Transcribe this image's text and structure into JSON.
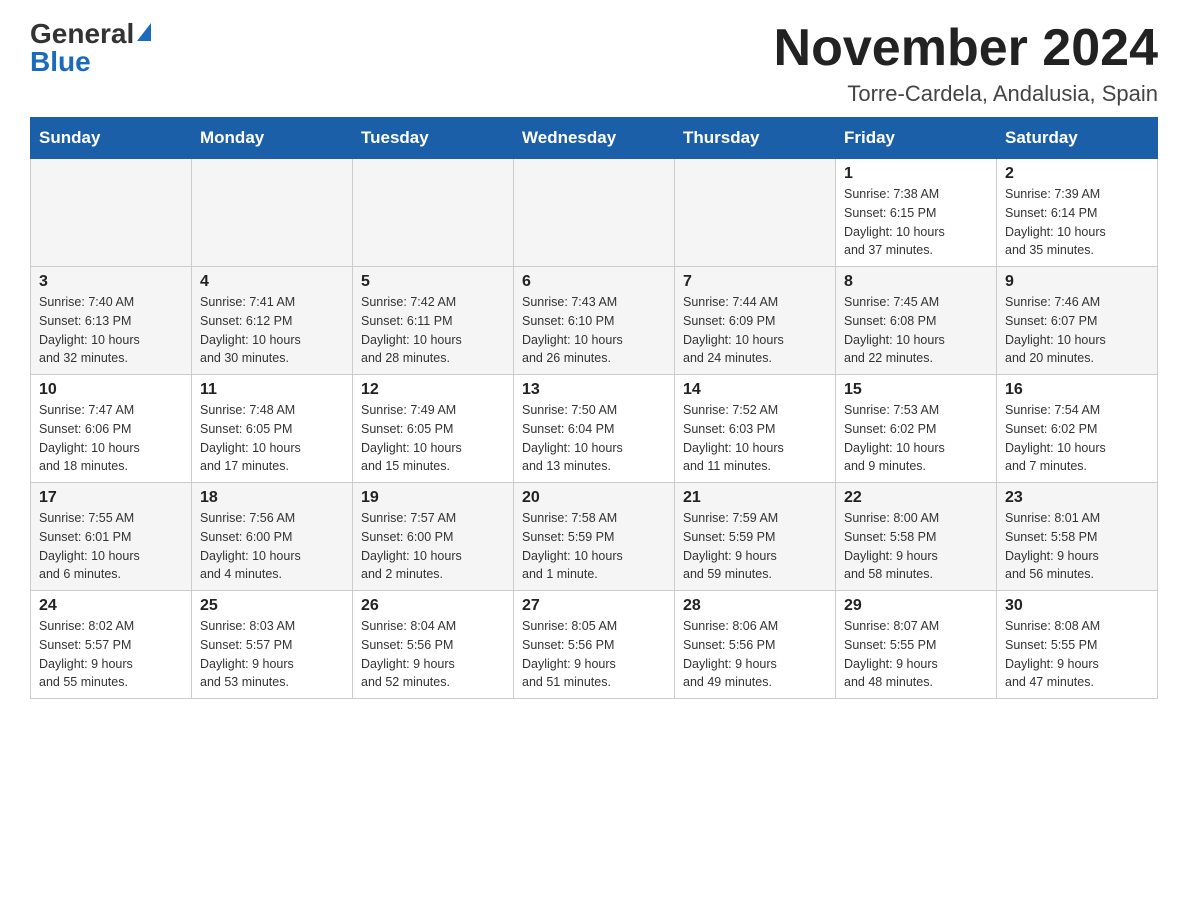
{
  "logo": {
    "line1": "General",
    "line2": "Blue"
  },
  "header": {
    "month": "November 2024",
    "location": "Torre-Cardela, Andalusia, Spain"
  },
  "days_of_week": [
    "Sunday",
    "Monday",
    "Tuesday",
    "Wednesday",
    "Thursday",
    "Friday",
    "Saturday"
  ],
  "weeks": [
    {
      "days": [
        {
          "num": "",
          "info": ""
        },
        {
          "num": "",
          "info": ""
        },
        {
          "num": "",
          "info": ""
        },
        {
          "num": "",
          "info": ""
        },
        {
          "num": "",
          "info": ""
        },
        {
          "num": "1",
          "info": "Sunrise: 7:38 AM\nSunset: 6:15 PM\nDaylight: 10 hours\nand 37 minutes."
        },
        {
          "num": "2",
          "info": "Sunrise: 7:39 AM\nSunset: 6:14 PM\nDaylight: 10 hours\nand 35 minutes."
        }
      ]
    },
    {
      "days": [
        {
          "num": "3",
          "info": "Sunrise: 7:40 AM\nSunset: 6:13 PM\nDaylight: 10 hours\nand 32 minutes."
        },
        {
          "num": "4",
          "info": "Sunrise: 7:41 AM\nSunset: 6:12 PM\nDaylight: 10 hours\nand 30 minutes."
        },
        {
          "num": "5",
          "info": "Sunrise: 7:42 AM\nSunset: 6:11 PM\nDaylight: 10 hours\nand 28 minutes."
        },
        {
          "num": "6",
          "info": "Sunrise: 7:43 AM\nSunset: 6:10 PM\nDaylight: 10 hours\nand 26 minutes."
        },
        {
          "num": "7",
          "info": "Sunrise: 7:44 AM\nSunset: 6:09 PM\nDaylight: 10 hours\nand 24 minutes."
        },
        {
          "num": "8",
          "info": "Sunrise: 7:45 AM\nSunset: 6:08 PM\nDaylight: 10 hours\nand 22 minutes."
        },
        {
          "num": "9",
          "info": "Sunrise: 7:46 AM\nSunset: 6:07 PM\nDaylight: 10 hours\nand 20 minutes."
        }
      ]
    },
    {
      "days": [
        {
          "num": "10",
          "info": "Sunrise: 7:47 AM\nSunset: 6:06 PM\nDaylight: 10 hours\nand 18 minutes."
        },
        {
          "num": "11",
          "info": "Sunrise: 7:48 AM\nSunset: 6:05 PM\nDaylight: 10 hours\nand 17 minutes."
        },
        {
          "num": "12",
          "info": "Sunrise: 7:49 AM\nSunset: 6:05 PM\nDaylight: 10 hours\nand 15 minutes."
        },
        {
          "num": "13",
          "info": "Sunrise: 7:50 AM\nSunset: 6:04 PM\nDaylight: 10 hours\nand 13 minutes."
        },
        {
          "num": "14",
          "info": "Sunrise: 7:52 AM\nSunset: 6:03 PM\nDaylight: 10 hours\nand 11 minutes."
        },
        {
          "num": "15",
          "info": "Sunrise: 7:53 AM\nSunset: 6:02 PM\nDaylight: 10 hours\nand 9 minutes."
        },
        {
          "num": "16",
          "info": "Sunrise: 7:54 AM\nSunset: 6:02 PM\nDaylight: 10 hours\nand 7 minutes."
        }
      ]
    },
    {
      "days": [
        {
          "num": "17",
          "info": "Sunrise: 7:55 AM\nSunset: 6:01 PM\nDaylight: 10 hours\nand 6 minutes."
        },
        {
          "num": "18",
          "info": "Sunrise: 7:56 AM\nSunset: 6:00 PM\nDaylight: 10 hours\nand 4 minutes."
        },
        {
          "num": "19",
          "info": "Sunrise: 7:57 AM\nSunset: 6:00 PM\nDaylight: 10 hours\nand 2 minutes."
        },
        {
          "num": "20",
          "info": "Sunrise: 7:58 AM\nSunset: 5:59 PM\nDaylight: 10 hours\nand 1 minute."
        },
        {
          "num": "21",
          "info": "Sunrise: 7:59 AM\nSunset: 5:59 PM\nDaylight: 9 hours\nand 59 minutes."
        },
        {
          "num": "22",
          "info": "Sunrise: 8:00 AM\nSunset: 5:58 PM\nDaylight: 9 hours\nand 58 minutes."
        },
        {
          "num": "23",
          "info": "Sunrise: 8:01 AM\nSunset: 5:58 PM\nDaylight: 9 hours\nand 56 minutes."
        }
      ]
    },
    {
      "days": [
        {
          "num": "24",
          "info": "Sunrise: 8:02 AM\nSunset: 5:57 PM\nDaylight: 9 hours\nand 55 minutes."
        },
        {
          "num": "25",
          "info": "Sunrise: 8:03 AM\nSunset: 5:57 PM\nDaylight: 9 hours\nand 53 minutes."
        },
        {
          "num": "26",
          "info": "Sunrise: 8:04 AM\nSunset: 5:56 PM\nDaylight: 9 hours\nand 52 minutes."
        },
        {
          "num": "27",
          "info": "Sunrise: 8:05 AM\nSunset: 5:56 PM\nDaylight: 9 hours\nand 51 minutes."
        },
        {
          "num": "28",
          "info": "Sunrise: 8:06 AM\nSunset: 5:56 PM\nDaylight: 9 hours\nand 49 minutes."
        },
        {
          "num": "29",
          "info": "Sunrise: 8:07 AM\nSunset: 5:55 PM\nDaylight: 9 hours\nand 48 minutes."
        },
        {
          "num": "30",
          "info": "Sunrise: 8:08 AM\nSunset: 5:55 PM\nDaylight: 9 hours\nand 47 minutes."
        }
      ]
    }
  ]
}
